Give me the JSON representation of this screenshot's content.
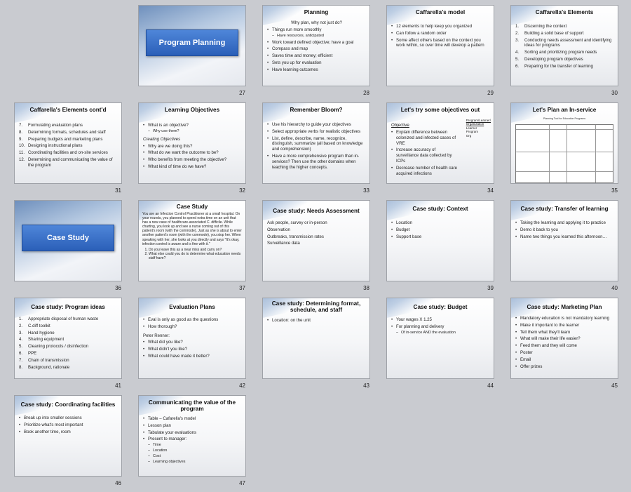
{
  "slides": {
    "s27": {
      "num": "27",
      "title": "Program Planning"
    },
    "s28": {
      "num": "28",
      "title": "Planning",
      "items": [
        "Why plan, why not just do?",
        "Things run more smoothly",
        "Have resources, anticipated",
        "Work toward defined objective; have a goal",
        "Compass and map",
        "Saves time and money; efficient",
        "Sets you up for evaluation",
        "Have learning outcomes"
      ]
    },
    "s29": {
      "num": "29",
      "title": "Caffarella's model",
      "items": [
        "12 elements to help keep you organized",
        "Can follow a random order",
        "Some affect others based on the context you work within, so over time will develop a pattern"
      ]
    },
    "s30": {
      "num": "30",
      "title": "Caffarella's Elements",
      "items": [
        "Discerning the context",
        "Building a solid base of support",
        "Conducting needs assessment and identifying ideas for programs",
        "Sorting and prioritizing program needs",
        "Developing program objectives",
        "Preparing for the transfer of learning"
      ]
    },
    "s31": {
      "num": "31",
      "title": "Caffarella's Elements cont'd",
      "items": [
        "Formulating evaluation plans",
        "Determining formats, schedules and staff",
        "Preparing budgets and marketing plans",
        "Designing instructional plans",
        "Coordinating facilities and on-site services",
        "Determining and communicating the value of the program"
      ]
    },
    "s32": {
      "num": "32",
      "title": "Learning Objectives",
      "items": [
        "What is an objective?",
        "Why use them?",
        "Creating Objectives",
        "Why are we doing this?",
        "What do we want the outcome to be?",
        "Who benefits from meeting the objective?",
        "What kind of time do we have?"
      ]
    },
    "s33": {
      "num": "33",
      "title": "Remember Bloom?",
      "items": [
        "Use his hierarchy to guide your objectives",
        "Select appropriate verbs for realistic objectives",
        "List, define, describe, name, recognize, distinguish, summarize (all based on knowledge and comprehension)",
        "Have a more comprehensive program than in-services? Then use the other domains when teaching the higher concepts."
      ]
    },
    "s34": {
      "num": "34",
      "title": "Let's try some objectives out",
      "heading": "Objective",
      "items": [
        "Explain difference between colonized and infected cases of VRE",
        "Increase accuracy of surveillance data collected by ICPs",
        "Decrease number of health care acquired infections"
      ],
      "side": [
        "Program/Learner/",
        "Organization",
        "Learner",
        "Program",
        "Org"
      ]
    },
    "s35": {
      "num": "35",
      "title": "Let's Plan an In-service",
      "subtitle": "Planning Tool for Education Programs"
    },
    "s36": {
      "num": "36",
      "title": "Case Study"
    },
    "s37": {
      "num": "37",
      "title": "Case Study",
      "text": "You are an Infection Control Practitioner at a small hospital. On your rounds, you planned to spend extra time on an unit that has a new case of healthcare-associated C. difficile. While charting, you look up and see a nurse coming out of this patient's room (with the commode). Just as she is about to enter another patient's room (with the commode), you stop her. When speaking with her, she looks at you directly and says \"It's okay, infection control is aware and is fine with it.\"",
      "items": [
        "Do you leave this as a near miss and carry on?",
        "What else could you do to determine what education needs staff have?"
      ]
    },
    "s38": {
      "num": "38",
      "title": "Case study: Needs Assessment",
      "items": [
        "Ask people, survey or in-person",
        "Observation",
        "Outbreaks, transmission rates",
        "Surveillance data"
      ]
    },
    "s39": {
      "num": "39",
      "title": "Case study: Context",
      "items": [
        "Location",
        "Budget",
        "Support base"
      ]
    },
    "s40": {
      "num": "40",
      "title": "Case study: Transfer of learning",
      "items": [
        "Taking the learning and applying it to practice",
        "Demo it back to you",
        "Name two things you learned this afternoon…"
      ]
    },
    "s41": {
      "num": "41",
      "title": "Case study: Program ideas",
      "items": [
        "Appropriate disposal of human waste",
        "C.diff toolkit",
        "Hand hygiene",
        "Sharing equipment",
        "Cleaning protocols / disinfection",
        "PPE",
        "Chain of transmission",
        "Background, rationale"
      ]
    },
    "s42": {
      "num": "42",
      "title": "Evaluation Plans",
      "items": [
        "Eval is only as good as the questions",
        "How thorough?",
        "Peter Renner:",
        "What did you like?",
        "What didn't you like?",
        "What could have made it better?"
      ]
    },
    "s43": {
      "num": "43",
      "title": "Case study: Determining format, schedule, and staff",
      "items": [
        "Location: on the unit"
      ]
    },
    "s44": {
      "num": "44",
      "title": "Case study: Budget",
      "items": [
        "Your wages X 1.25",
        "For planning and delivery",
        "Of in-service AND the evaluation"
      ]
    },
    "s45": {
      "num": "45",
      "title": "Case study: Marketing Plan",
      "items": [
        "Mandatory education is not mandatory learning",
        "Make it important to the learner",
        "Tell them what they'll learn",
        "What will make their life easier?",
        "Feed them and they will come",
        "Poster",
        "Email",
        "Offer prizes"
      ]
    },
    "s46": {
      "num": "46",
      "title": "Case study: Coordinating facilities",
      "items": [
        "Break up into smaller sessions",
        "Prioritize what's most important",
        "Book another time, room"
      ]
    },
    "s47": {
      "num": "47",
      "title": "Communicating the value of the program",
      "items": [
        "Table – Cafarella's model",
        "Lesson plan",
        "Tabulate your evaluations",
        "Present to manager:",
        "Time",
        "Location",
        "Cost",
        "Learning objectives"
      ]
    }
  }
}
